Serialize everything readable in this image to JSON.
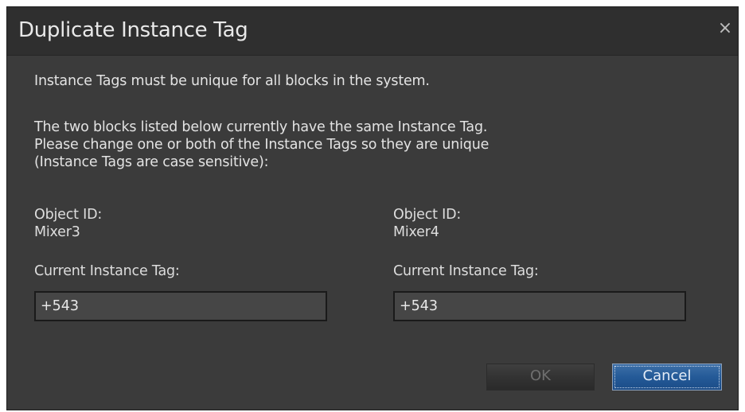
{
  "dialog": {
    "title": "Duplicate Instance Tag",
    "close_glyph": "×",
    "message_line1": "Instance Tags must be unique for all blocks in the system.",
    "message_lines": [
      "The two blocks listed below currently have the same Instance Tag.",
      "Please change one or both of the Instance Tags so they are unique",
      "(Instance Tags are case sensitive):"
    ],
    "left": {
      "object_id_label": "Object ID:",
      "object_id": "Mixer3",
      "tag_label": "Current Instance Tag:",
      "tag_value": "+543"
    },
    "right": {
      "object_id_label": "Object ID:",
      "object_id": "Mixer4",
      "tag_label": "Current Instance Tag:",
      "tag_value": "+543"
    },
    "buttons": {
      "ok": "OK",
      "cancel": "Cancel"
    }
  },
  "colors": {
    "background": "#3b3b3b",
    "titlebar": "#2f2f2f",
    "input_bg": "#464646",
    "accent": "#245a98"
  }
}
